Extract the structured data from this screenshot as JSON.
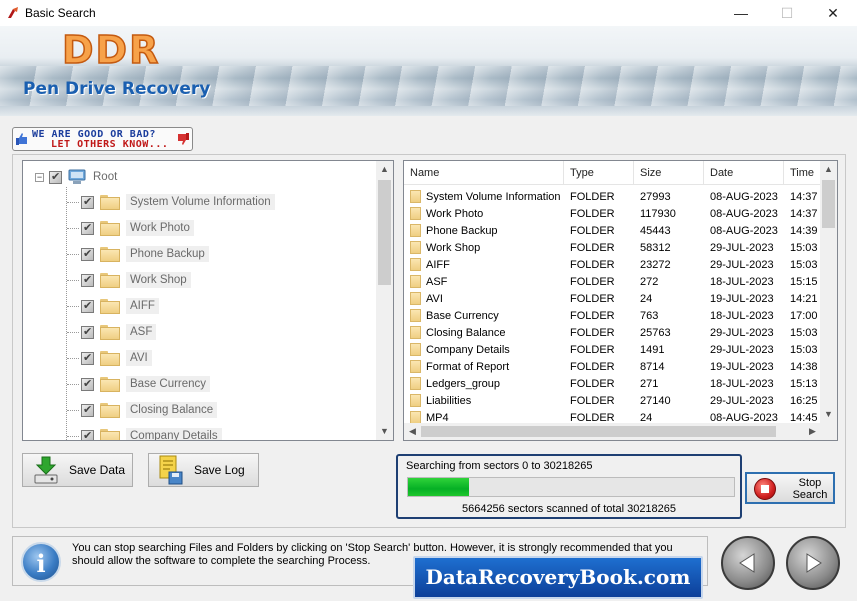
{
  "window": {
    "title": "Basic Search",
    "min_glyph": "—",
    "max_glyph": "☐",
    "close_glyph": "✕"
  },
  "banner": {
    "logo": "DDR",
    "product": "Pen Drive Recovery"
  },
  "feedback": {
    "line1": "WE ARE GOOD OR BAD?",
    "line2": "LET OTHERS KNOW..."
  },
  "tree": {
    "root_label": "Root",
    "items": [
      "System Volume Information",
      "Work Photo",
      "Phone Backup",
      "Work Shop",
      "AIFF",
      "ASF",
      "AVI",
      "Base Currency",
      "Closing Balance",
      "Company Details"
    ]
  },
  "table": {
    "columns": [
      "Name",
      "Type",
      "Size",
      "Date",
      "Time"
    ],
    "rows": [
      [
        "System Volume Information",
        "FOLDER",
        "27993",
        "08-AUG-2023",
        "14:37"
      ],
      [
        "Work Photo",
        "FOLDER",
        "117930",
        "08-AUG-2023",
        "14:37"
      ],
      [
        "Phone Backup",
        "FOLDER",
        "45443",
        "08-AUG-2023",
        "14:39"
      ],
      [
        "Work Shop",
        "FOLDER",
        "58312",
        "29-JUL-2023",
        "15:03"
      ],
      [
        "AIFF",
        "FOLDER",
        "23272",
        "29-JUL-2023",
        "15:03"
      ],
      [
        "ASF",
        "FOLDER",
        "272",
        "18-JUL-2023",
        "15:15"
      ],
      [
        "AVI",
        "FOLDER",
        "24",
        "19-JUL-2023",
        "14:21"
      ],
      [
        "Base Currency",
        "FOLDER",
        "763",
        "18-JUL-2023",
        "17:00"
      ],
      [
        "Closing Balance",
        "FOLDER",
        "25763",
        "29-JUL-2023",
        "15:03"
      ],
      [
        "Company Details",
        "FOLDER",
        "1491",
        "29-JUL-2023",
        "15:03"
      ],
      [
        "Format of Report",
        "FOLDER",
        "8714",
        "19-JUL-2023",
        "14:38"
      ],
      [
        "Ledgers_group",
        "FOLDER",
        "271",
        "18-JUL-2023",
        "15:13"
      ],
      [
        "Liabilities",
        "FOLDER",
        "27140",
        "29-JUL-2023",
        "16:25"
      ],
      [
        "MP4",
        "FOLDER",
        "24",
        "08-AUG-2023",
        "14:45"
      ]
    ]
  },
  "buttons": {
    "save_data": "Save Data",
    "save_log": "Save Log",
    "stop_line1": "Stop",
    "stop_line2": "Search"
  },
  "progress": {
    "line1": "Searching from sectors   0  to 30218265",
    "line2": "5664256   sectors scanned of total 30218265",
    "fraction": 0.1874
  },
  "info": {
    "message": "You can stop searching Files and Folders by clicking on 'Stop Search' button. However, it is strongly recommended that you should allow the software to complete the searching Process."
  },
  "brand": {
    "text": "DataRecoveryBook.com"
  },
  "icons": {
    "app": "app-icon",
    "back": "back-arrow-icon",
    "forward": "forward-arrow-icon",
    "info": "info-icon",
    "stop": "stop-icon",
    "drive": "drive-icon",
    "folder": "folder-icon"
  },
  "colors": {
    "progress_fill": "#06b025",
    "brand_bg": "#0d3f99",
    "product_text": "#1a5fb0",
    "logo": "#f7a24a"
  }
}
